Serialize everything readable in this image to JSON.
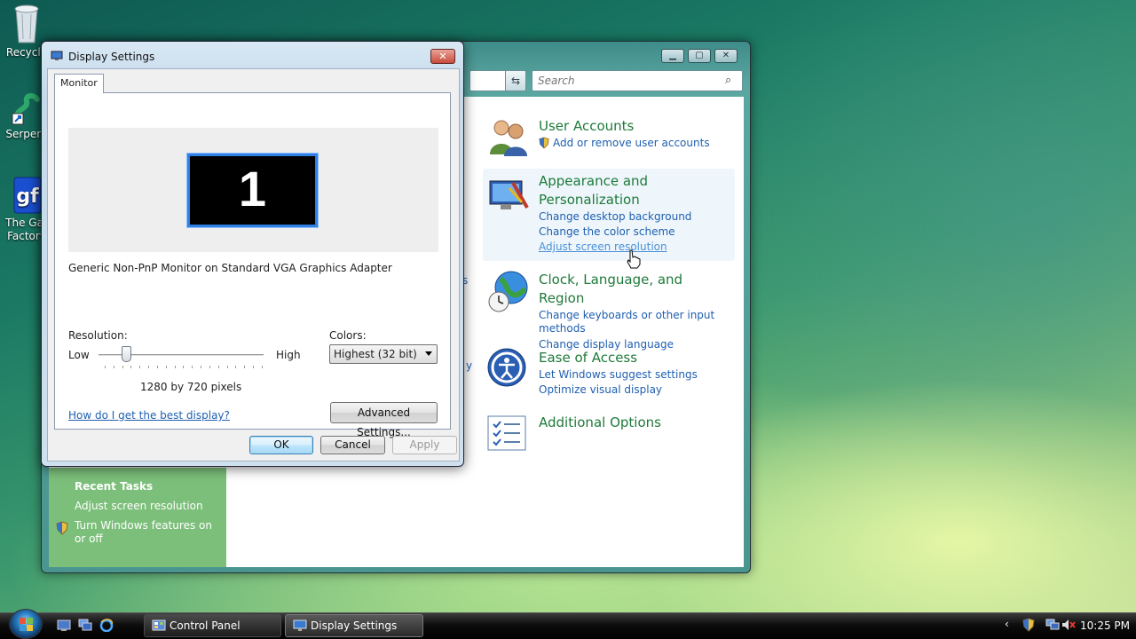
{
  "desktop": {
    "icons": [
      {
        "label": "Recycle",
        "icon": "recycle-bin-icon"
      },
      {
        "label": "Serpent",
        "icon": "serpent-game-icon"
      },
      {
        "label": "The Gar Factory",
        "icon": "game-factory-icon"
      }
    ]
  },
  "control_panel": {
    "search_placeholder": "Search",
    "address_fragment": "▾",
    "categories": [
      {
        "title": "User Accounts",
        "links": [
          "Add or remove user accounts"
        ],
        "icon": "user-accounts-icon"
      },
      {
        "title": "Appearance and Personalization",
        "links": [
          "Change desktop background",
          "Change the color scheme",
          "Adjust screen resolution"
        ],
        "icon": "appearance-icon"
      },
      {
        "title": "Clock, Language, and Region",
        "links": [
          "Change keyboards or other input methods",
          "Change display language"
        ],
        "icon": "clock-globe-icon"
      },
      {
        "title": "Ease of Access",
        "links": [
          "Let Windows suggest settings",
          "Optimize visual display"
        ],
        "icon": "ease-of-access-icon"
      },
      {
        "title": "Additional Options",
        "links": [],
        "icon": "additional-options-icon"
      }
    ],
    "recent_tasks": {
      "heading": "Recent Tasks",
      "items": [
        "Adjust screen resolution",
        "Turn Windows features on or off"
      ]
    },
    "peek_text": [
      "s",
      "y"
    ]
  },
  "display_settings": {
    "title": "Display Settings",
    "tab": "Monitor",
    "monitor_number": "1",
    "monitor_description": "Generic Non-PnP Monitor on Standard VGA Graphics Adapter",
    "resolution_label": "Resolution:",
    "low_label": "Low",
    "high_label": "High",
    "resolution_value": "1280 by 720 pixels",
    "resolution_slider_fraction": 0.15,
    "colors_label": "Colors:",
    "colors_value": "Highest (32 bit)",
    "help_link": "How do I get the best display?",
    "advanced_button": "Advanced Settings...",
    "ok_button": "OK",
    "cancel_button": "Cancel",
    "apply_button": "Apply"
  },
  "taskbar": {
    "buttons": [
      {
        "label": "Control Panel",
        "active": false
      },
      {
        "label": "Display Settings",
        "active": true
      }
    ],
    "clock": "10:25 PM"
  },
  "colors": {
    "link": "#1f5fb0",
    "category_title": "#1e7a3a",
    "selection_blue": "#2f7fe2",
    "recent_tasks_bg": "#7cbf7a"
  }
}
